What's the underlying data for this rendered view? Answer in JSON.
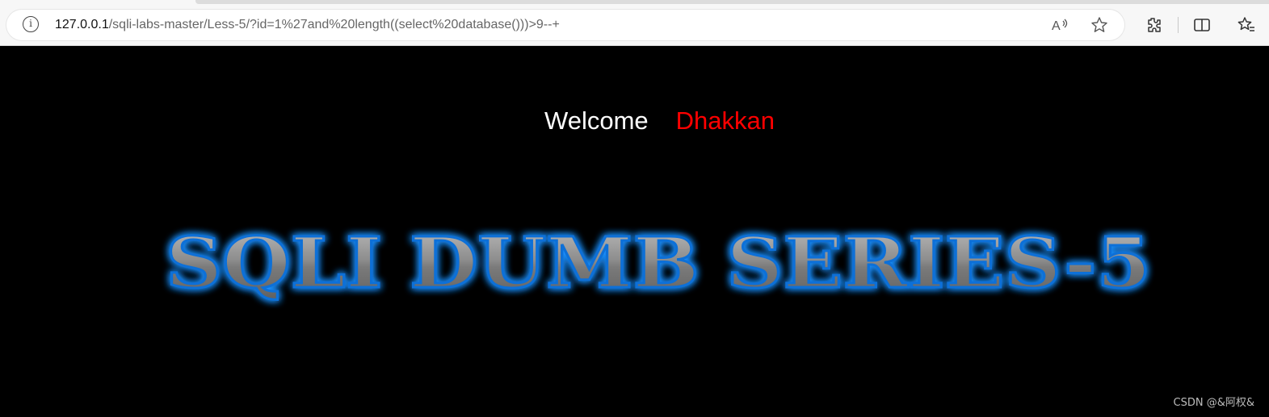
{
  "browser": {
    "url_host": "127.0.0.1",
    "url_path": "/sqli-labs-master/Less-5/?id=1%27and%20length((select%20database()))>9--+",
    "icons": [
      "info-icon",
      "read-aloud-icon",
      "favorite-star-icon",
      "extensions-icon",
      "split-screen-icon",
      "favorites-icon"
    ]
  },
  "page": {
    "welcome_text": "Welcome",
    "user_text": "Dhakkan",
    "banner_text": "SQLI DUMB SERIES-5",
    "watermark": "CSDN @&阿权&"
  },
  "colors": {
    "background": "#000000",
    "welcome": "#ffffff",
    "user": "#ff0000",
    "banner_glow": "#1e90ff",
    "banner_fill": "#8a8a8a"
  }
}
